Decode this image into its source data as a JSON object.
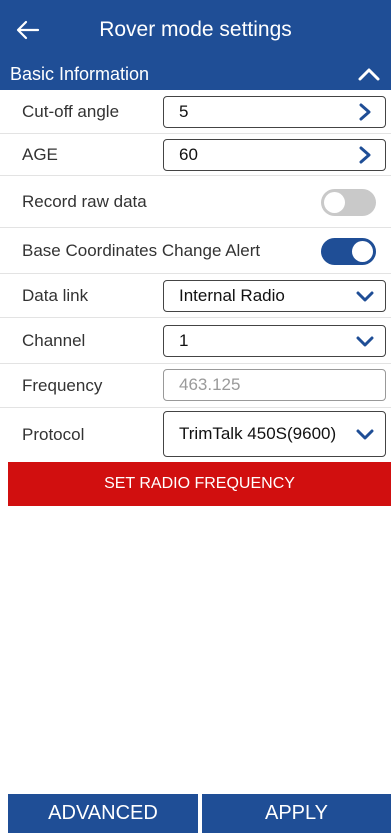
{
  "header": {
    "title": "Rover mode settings",
    "back_icon": "arrow-left-icon"
  },
  "section": {
    "title": "Basic Information",
    "expanded": true
  },
  "fields": {
    "cutoff_angle": {
      "label": "Cut-off angle",
      "value": "5"
    },
    "age": {
      "label": "AGE",
      "value": "60"
    },
    "record_raw_data": {
      "label": "Record raw data",
      "enabled": false
    },
    "base_coord_alert": {
      "label": "Base Coordinates Change Alert",
      "enabled": true
    },
    "data_link": {
      "label": "Data link",
      "value": "Internal Radio"
    },
    "channel": {
      "label": "Channel",
      "value": "1"
    },
    "frequency": {
      "label": "Frequency",
      "value": "463.125"
    },
    "protocol": {
      "label": "Protocol",
      "value": "TrimTalk 450S(9600)"
    }
  },
  "buttons": {
    "set_radio_frequency": "SET RADIO FREQUENCY",
    "advanced": "ADVANCED",
    "apply": "APPLY"
  },
  "colors": {
    "primary": "#1f4e96",
    "danger": "#d10f0f",
    "toggle_off": "#c9c9c9"
  }
}
